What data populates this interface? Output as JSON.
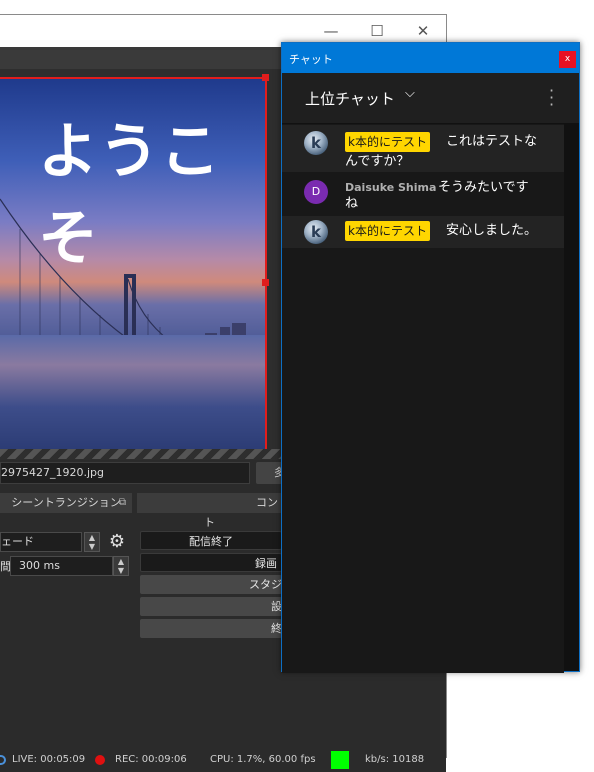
{
  "obs": {
    "window_controls": {
      "minimize": "—",
      "maximize": "☐",
      "close": "✕"
    },
    "preview": {
      "welcome_text": "ようこそ"
    },
    "source_file": "2975427_1920.jpg",
    "side_button": "多",
    "scene_transitions": {
      "title": "シーントランジション",
      "transition_value": "ェード",
      "duration_label": "間",
      "duration_value": "300 ms"
    },
    "controls": {
      "title": "コント",
      "stop_streaming": "配信終了",
      "recording": "録画",
      "studio": "スタジ",
      "btn4": "設",
      "btn5": "終"
    },
    "status": {
      "live": "LIVE: 00:05:09",
      "rec": "REC: 00:09:06",
      "cpu": "CPU: 1.7%, 60.00 fps",
      "kbs": "kb/s: 10188"
    }
  },
  "chat": {
    "window_title": "チャット",
    "close_glyph": "x",
    "header_title": "上位チャット",
    "chevron_glyph": "⌵",
    "kebab_glyph": "⋮",
    "messages": [
      {
        "author": "k本的にテスト",
        "text_line1": "これはテストな",
        "text_line2": "んですか？",
        "avatar": "k"
      },
      {
        "author": "Daisuke Shima",
        "text_line1": "そうみたいです",
        "text_line2": "ね",
        "avatar": "D"
      },
      {
        "author": "k本的にテスト",
        "text_line1": "安心しました。",
        "avatar": "k"
      }
    ]
  },
  "colors": {
    "chat_titlebar": "#0078d7",
    "author_badge": "#ffd600",
    "rec_indicator": "#e01010",
    "stream_health": "#00ff00"
  }
}
